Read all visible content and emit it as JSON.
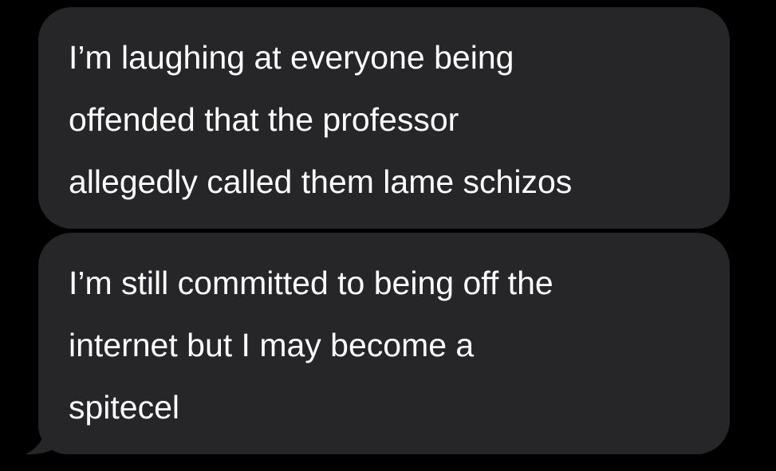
{
  "messages": [
    {
      "lines": [
        "I’m laughing at everyone being",
        "offended that the professor",
        "allegedly called them lame schizos"
      ]
    },
    {
      "lines": [
        "I’m still committed to being off the",
        "internet but I may become a",
        "spitecel"
      ]
    }
  ],
  "colors": {
    "background": "#000000",
    "bubble": "#262628",
    "text": "#ffffff"
  }
}
